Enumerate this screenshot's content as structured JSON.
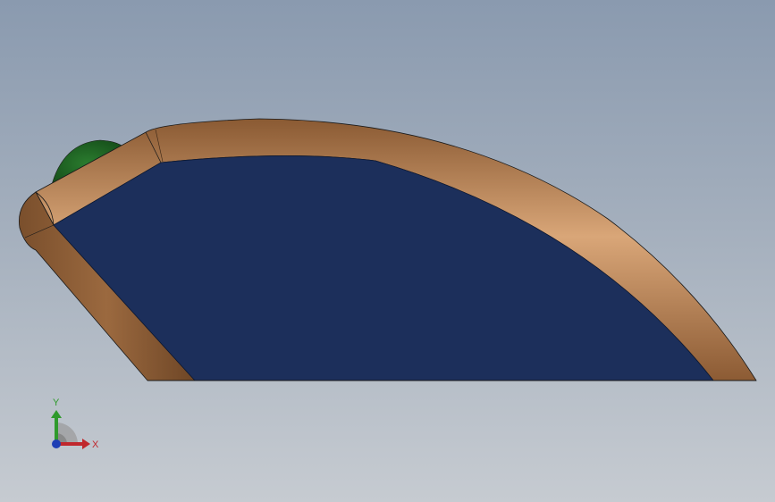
{
  "viewport": {
    "background_top": "#8a9aaf",
    "background_bottom": "#c6cbd1"
  },
  "model": {
    "face_color": "#1c2f5b",
    "frame_color": "#a26d41",
    "frame_highlight": "#d6a478",
    "knob_color": "#1f6a24",
    "edge_color": "#1a1a1a"
  },
  "triad": {
    "x_label": "X",
    "y_label": "Y",
    "x_color": "#c0282d",
    "y_color": "#2f9a2c",
    "z_color": "#1f3fb5"
  }
}
